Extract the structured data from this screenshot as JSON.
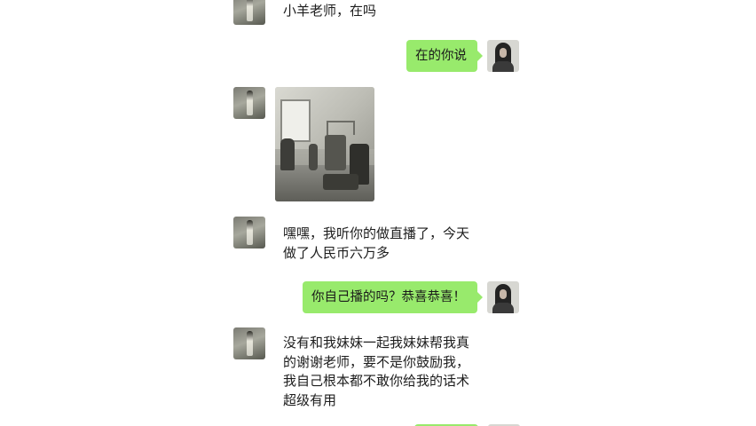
{
  "chat": {
    "messages": [
      {
        "side": "left",
        "type": "text",
        "text": "小羊老师，在吗"
      },
      {
        "side": "right",
        "type": "text",
        "text": "在的你说"
      },
      {
        "side": "left",
        "type": "image",
        "image": "photo of a room with filming equipment"
      },
      {
        "side": "left",
        "type": "text",
        "text": "嘿嘿，我听你的做直播了，今天\n做了人民币六万多"
      },
      {
        "side": "right",
        "type": "text",
        "text": "你自己播的吗？恭喜恭喜！"
      },
      {
        "side": "left",
        "type": "text",
        "text": "没有和我妹妹一起我妹妹帮我真\n的谢谢老师，要不是你鼓励我，\n我自己根本都不敢你给我的话术\n超级有用"
      },
      {
        "side": "right",
        "type": "text",
        "text": ""
      }
    ]
  },
  "colors": {
    "background": "#ffffff",
    "outgoing_bubble": "#98ea6c",
    "text": "#1a1a1a"
  },
  "icons": {
    "contact_avatar": "user-avatar-icon",
    "self_avatar": "self-avatar-icon"
  }
}
